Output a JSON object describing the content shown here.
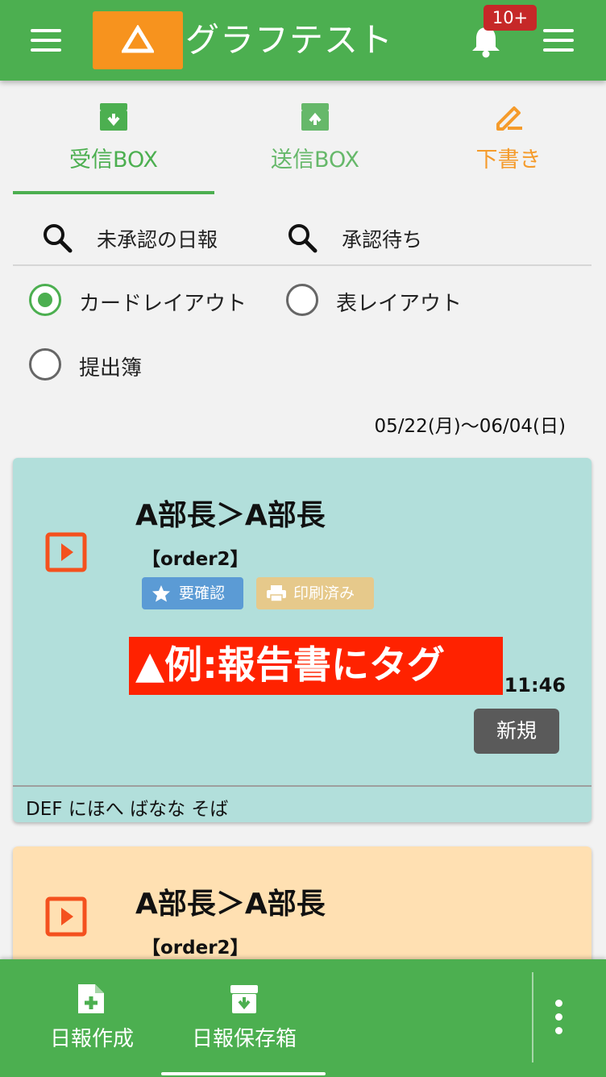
{
  "header": {
    "title": "グラフテスト",
    "notification_count": "10+",
    "brand_color": "#4caf50",
    "logo_color": "#f7931e"
  },
  "tabs": [
    {
      "label": "受信BOX",
      "icon": "inbox-icon",
      "color": "#4caf50",
      "active": true
    },
    {
      "label": "送信BOX",
      "icon": "outbox-icon",
      "color": "#66b86a",
      "active": false
    },
    {
      "label": "下書き",
      "icon": "pencil-icon",
      "color": "#f59b2b",
      "active": false
    }
  ],
  "filters": [
    {
      "label": "未承認の日報",
      "icon": "search-icon"
    },
    {
      "label": "承認待ち",
      "icon": "search-icon"
    }
  ],
  "layout_options": [
    {
      "label": "カードレイアウト",
      "selected": true
    },
    {
      "label": "表レイアウト",
      "selected": false
    },
    {
      "label": "提出簿",
      "selected": false
    }
  ],
  "date_range": "05/22(月)〜06/04(日)",
  "cards": [
    {
      "title": "A部長＞A部長",
      "order": "【order2】",
      "chips": [
        {
          "label": "要確認",
          "icon": "star-icon",
          "color": "#5b9bd5"
        },
        {
          "label": "印刷済み",
          "icon": "printer-icon",
          "color": "#e6c98b"
        }
      ],
      "overlay_tag": "▲例:報告書にタグ",
      "time": "11:46",
      "status_button": "新規",
      "footer": "DEF にほへ ばなな そば",
      "background": "#b2dfdb"
    },
    {
      "title": "A部長＞A部長",
      "order": "【order2】",
      "background": "#ffe0b2"
    }
  ],
  "bottom_nav": [
    {
      "label": "日報作成",
      "icon": "add-file-icon"
    },
    {
      "label": "日報保存箱",
      "icon": "archive-icon",
      "active": true
    }
  ]
}
